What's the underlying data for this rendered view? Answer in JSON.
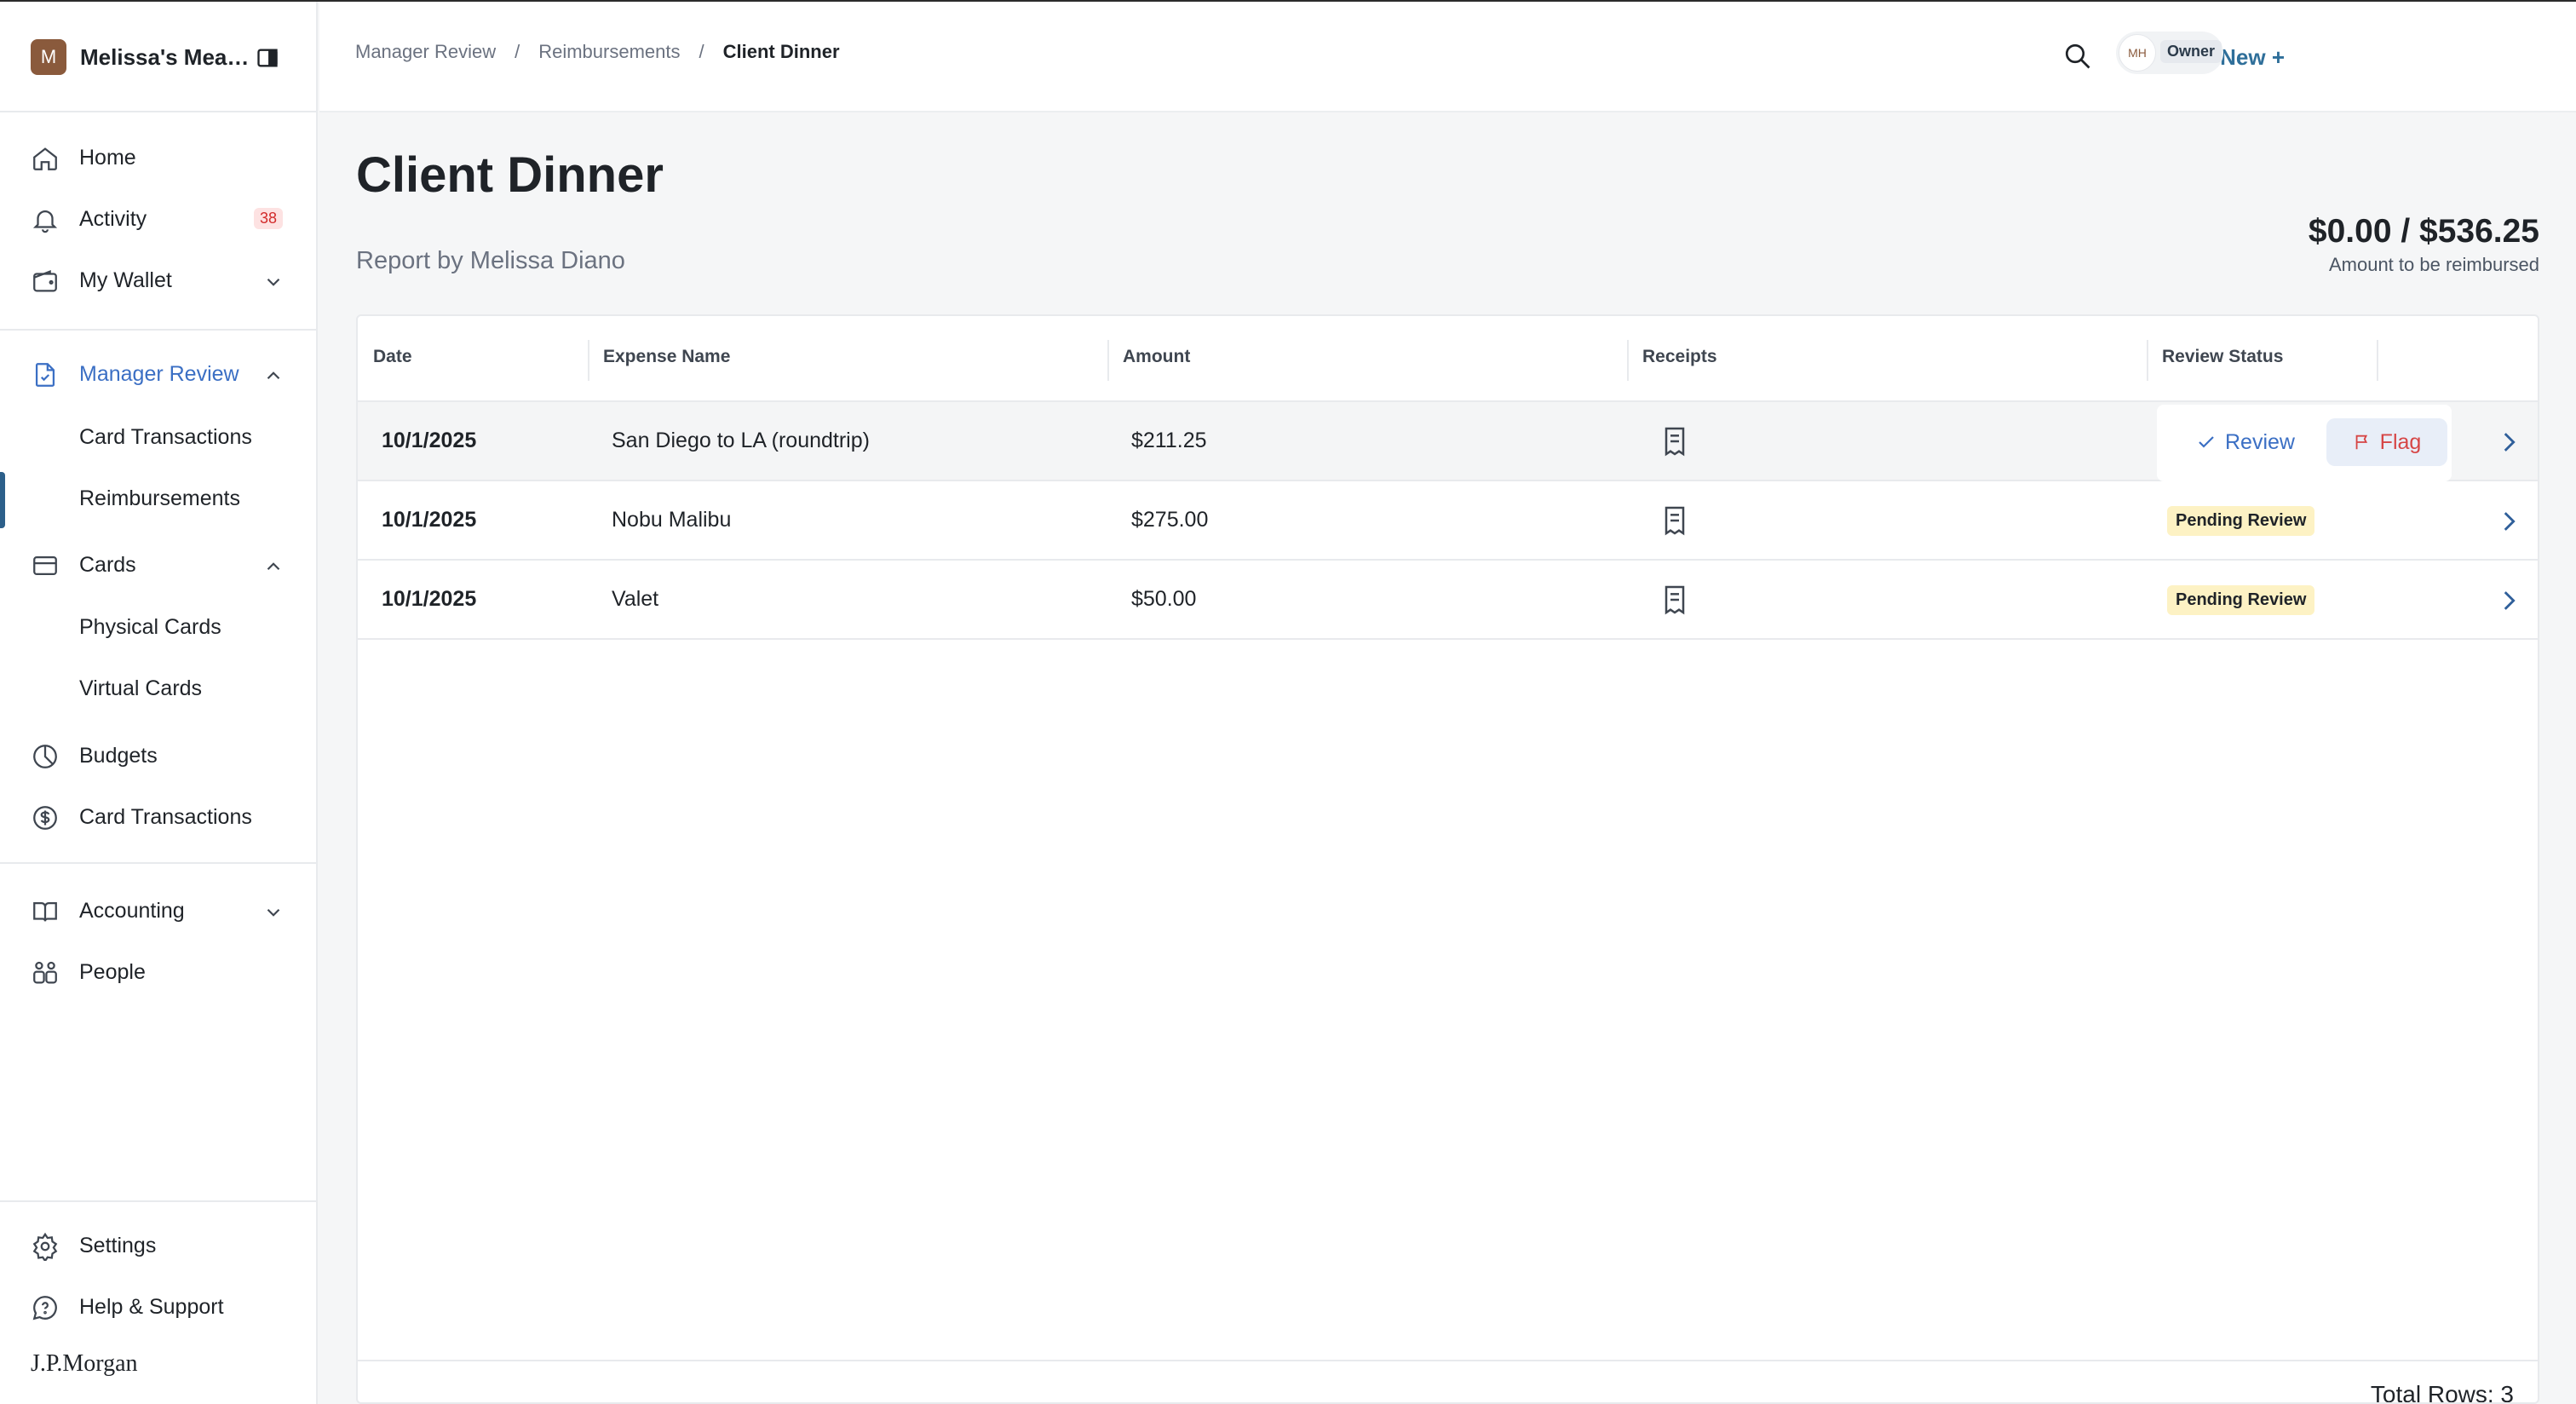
{
  "app": {
    "org_name": "Melissa's Mea…",
    "org_initial": "M",
    "footer_logo": "J.P.Morgan"
  },
  "sidebar": {
    "items": [
      {
        "label": "Home",
        "icon": "home-icon"
      },
      {
        "label": "Activity",
        "icon": "bell-icon",
        "badge": "38"
      },
      {
        "label": "My Wallet",
        "icon": "wallet-icon"
      },
      {
        "label": "Manager Review",
        "icon": "document-check-icon"
      },
      {
        "label": "Card Transactions"
      },
      {
        "label": "Reimbursements"
      },
      {
        "label": "Cards",
        "icon": "credit-card-icon"
      },
      {
        "label": "Physical Cards"
      },
      {
        "label": "Virtual Cards"
      },
      {
        "label": "Budgets",
        "icon": "pie-clock-icon"
      },
      {
        "label": "Card Transactions",
        "icon": "dollar-circle-icon"
      },
      {
        "label": "Accounting",
        "icon": "book-icon"
      },
      {
        "label": "People",
        "icon": "people-icon"
      },
      {
        "label": "Settings",
        "icon": "gear-icon"
      },
      {
        "label": "Help & Support",
        "icon": "help-bubble-icon"
      }
    ]
  },
  "header": {
    "breadcrumbs": [
      "Manager Review",
      "Reimbursements",
      "Client Dinner"
    ],
    "separator": "/",
    "create_label": "Create New +",
    "user_initials": "MH",
    "user_role": "Owner"
  },
  "page": {
    "title": "Client Dinner",
    "subtitle": "Report by Melissa Diano",
    "amount": "$0.00 / $536.25",
    "amount_caption": "Amount to be reimbursed"
  },
  "table": {
    "columns": [
      "Date",
      "Expense Name",
      "Amount",
      "Receipts",
      "Review Status"
    ],
    "rows": [
      {
        "date": "10/1/2025",
        "name": "San Diego to LA (roundtrip)",
        "amount": "$211.25",
        "status": ""
      },
      {
        "date": "10/1/2025",
        "name": "Nobu Malibu",
        "amount": "$275.00",
        "status": "Pending Review"
      },
      {
        "date": "10/1/2025",
        "name": "Valet",
        "amount": "$50.00",
        "status": "Pending Review"
      }
    ],
    "review_label": "Review",
    "flag_label": "Flag",
    "total_rows": "Total Rows: 3"
  },
  "colors": {
    "accent": "#3b6fc4",
    "brand": "#2f6f9a",
    "flag": "#d64545",
    "pending_bg": "#fdf2c4"
  }
}
